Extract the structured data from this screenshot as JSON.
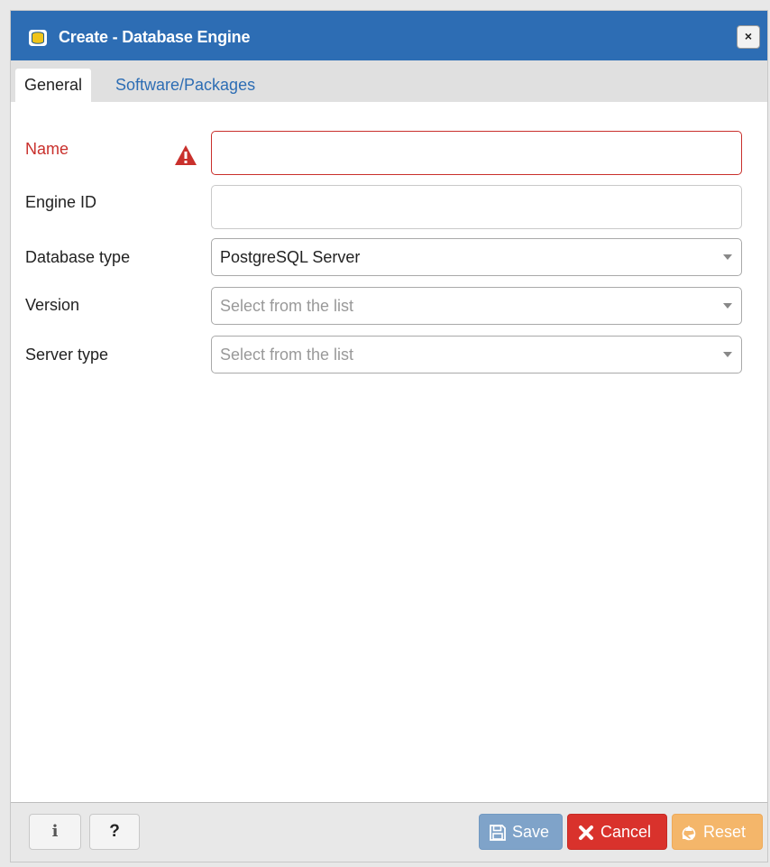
{
  "dialog": {
    "title": "Create - Database Engine",
    "close_label": "×",
    "title_icon": "database-icon"
  },
  "tabs": [
    {
      "label": "General",
      "active": true
    },
    {
      "label": "Software/Packages",
      "active": false
    }
  ],
  "form": {
    "name": {
      "label": "Name",
      "value": "",
      "error": true,
      "icon": "warning-icon"
    },
    "engine_id": {
      "label": "Engine ID",
      "value": ""
    },
    "database_type": {
      "label": "Database type",
      "value": "PostgreSQL Server"
    },
    "version": {
      "label": "Version",
      "placeholder": "Select from the list"
    },
    "server_type": {
      "label": "Server type",
      "placeholder": "Select from the list"
    }
  },
  "footer": {
    "info_label": "i",
    "help_label": "?",
    "save_label": "Save",
    "cancel_label": "Cancel",
    "reset_label": "Reset"
  },
  "colors": {
    "titlebar": "#2d6db4",
    "error": "#c9302c",
    "save": "#7fa3c9",
    "cancel": "#d9322c",
    "reset": "#f4b66a"
  }
}
